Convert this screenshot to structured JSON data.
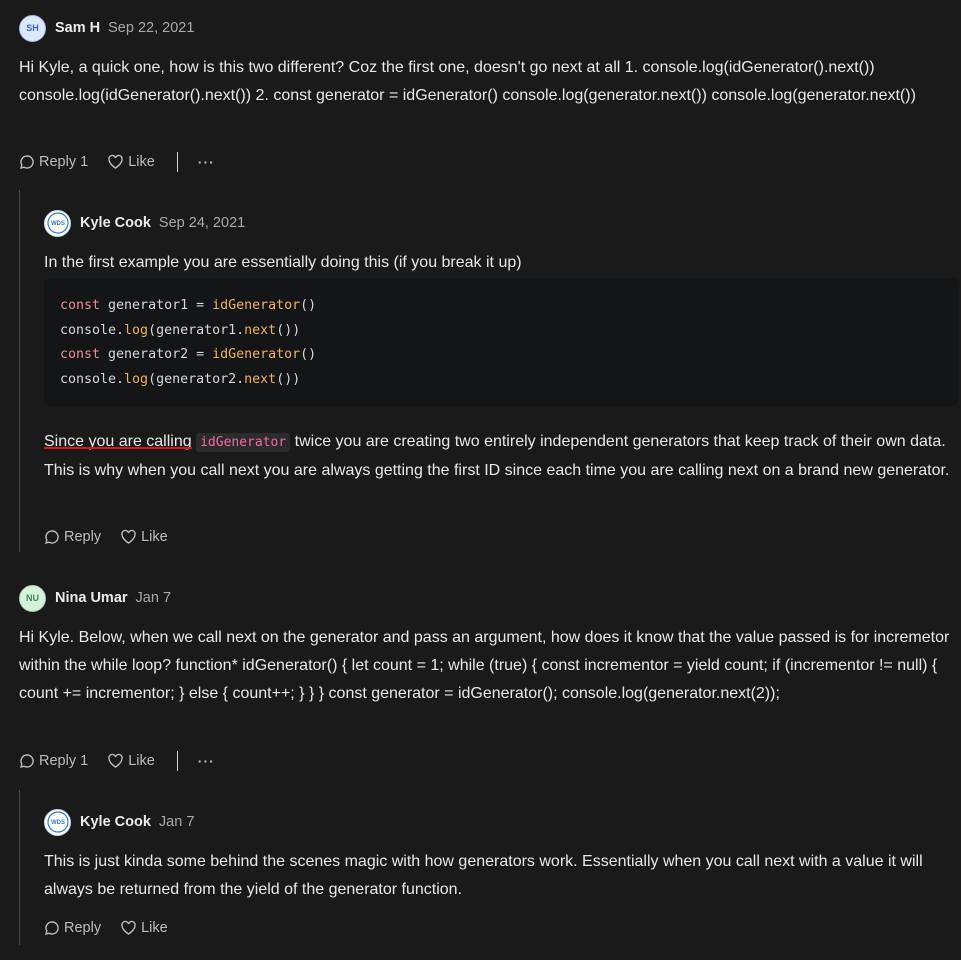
{
  "comments": [
    {
      "avatar_initials": "SH",
      "author": "Sam H",
      "date": "Sep 22, 2021",
      "text": "Hi Kyle, a quick one, how is this two different? Coz the first one, doesn't go next at all 1. console.log(idGenerator().next()) console.log(idGenerator().next()) 2. const generator = idGenerator() console.log(generator.next()) console.log(generator.next())",
      "reply_label": "Reply",
      "reply_count": "1",
      "like_label": "Like",
      "more_label": "···",
      "replies": [
        {
          "author": "Kyle Cook",
          "date": "Sep 24, 2021",
          "intro_text": "In the first example you are essentially doing this (if you break it up)",
          "code": [
            {
              "kw": "const",
              "var": " generator1 = ",
              "fn": "idGenerator",
              "rest": "()"
            },
            {
              "obj": "console.",
              "fn": "log",
              "mid": "(generator1.",
              "fn2": "next",
              "rest": "())"
            },
            {
              "kw": "const",
              "var": " generator2 = ",
              "fn": "idGenerator",
              "rest": "()"
            },
            {
              "obj": "console.",
              "fn": "log",
              "mid": "(generator2.",
              "fn2": "next",
              "rest": "())"
            }
          ],
          "body": {
            "p1": "Since you are calling",
            "inline_code": "idGenerator",
            "p2": "twice you are creating two entirely independent generators that keep track of their own data. This is why when you call next you are always getting the first ID since each time you are calling next on a brand new generator."
          },
          "reply_label": "Reply",
          "like_label": "Like"
        }
      ]
    },
    {
      "avatar_initials": "NU",
      "author": "Nina Umar",
      "date": "Jan 7",
      "text": "Hi Kyle. Below, when we call next on the generator and pass an argument, how does it know that the value passed is for incremetor within the while loop? function* idGenerator() { let count = 1; while (true) { const incrementor = yield count; if (incrementor != null) { count += incrementor; } else { count++; } } } const generator = idGenerator(); console.log(generator.next(2));",
      "reply_label": "Reply",
      "reply_count": "1",
      "like_label": "Like",
      "more_label": "···",
      "replies": [
        {
          "author": "Kyle Cook",
          "date": "Jan 7",
          "text": "This is just kinda some behind the scenes magic with how generators work. Essentially when you call next with a value it will always be returned from the yield of the generator function.",
          "reply_label": "Reply",
          "like_label": "Like"
        }
      ]
    }
  ],
  "wds_logo_text": "WDS"
}
